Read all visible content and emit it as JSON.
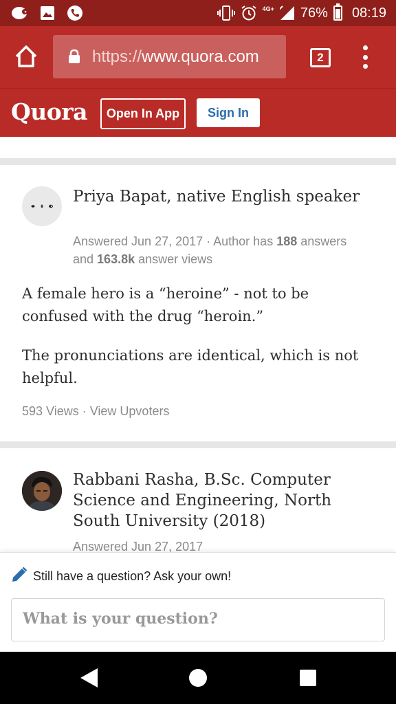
{
  "status_bar": {
    "battery": "76%",
    "time": "08:19",
    "network": "4G+",
    "left_icons": [
      "sheep-notification-icon",
      "image-notification-icon",
      "phone-notification-icon"
    ],
    "right_icons": [
      "vibrate-icon",
      "alarm-icon",
      "data-arrows-icon",
      "signal-icon",
      "battery-icon"
    ]
  },
  "browser": {
    "url_scheme": "https://",
    "url_host": "www.quora.com",
    "tab_count": "2"
  },
  "header": {
    "logo": "Quora",
    "open_in_app": "Open In App",
    "sign_in": "Sign In"
  },
  "answers": [
    {
      "author": "Priya Bapat, native English speaker",
      "meta_prefix": "Answered Jun 27, 2017 · Author has ",
      "answers_count": "188",
      "meta_middle": " answers and ",
      "views_count": "163.8k",
      "meta_suffix": " answer views",
      "paragraphs": [
        "A female hero is a “heroine” - not to be confused with the drug “heroin.”",
        "The pronunciations are identical, which is not helpful."
      ],
      "views": "593 Views",
      "separator": " · ",
      "upvoters": "View Upvoters"
    },
    {
      "author": "Rabbani Rasha, B.Sc. Computer Science and Engineering, North South University (2018)",
      "meta": "Answered Jun 27, 2017"
    }
  ],
  "ask_panel": {
    "prompt": "Still have a question? Ask your own!",
    "placeholder": "What is your question?"
  },
  "colors": {
    "brand": "#b92b27",
    "status_bar": "#8e1f1a",
    "sign_in_text": "#2b6dad"
  }
}
